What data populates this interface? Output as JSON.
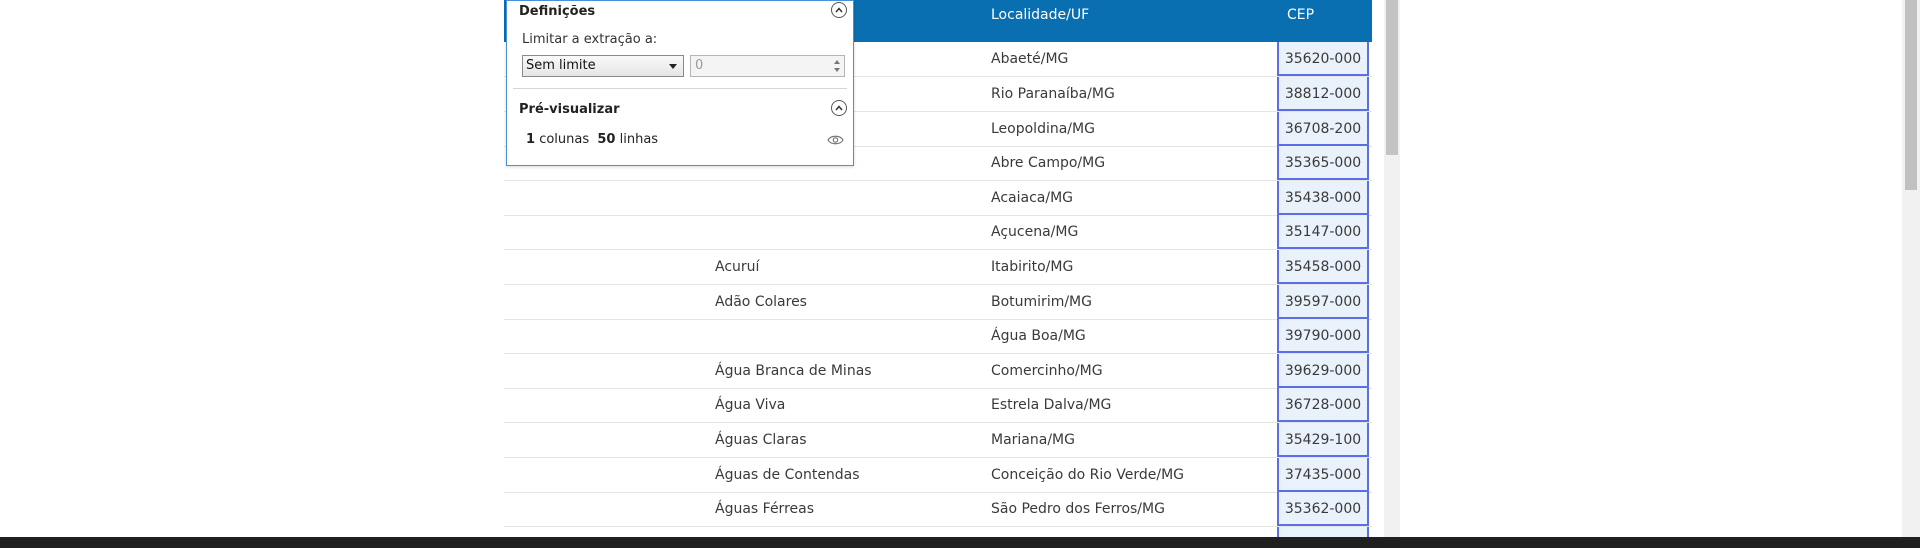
{
  "table": {
    "headers": {
      "localidade": "Localidade/UF",
      "cep": "CEP"
    },
    "rows": [
      {
        "bairro": "",
        "localidade": "Abaeté/MG",
        "cep": "35620-000"
      },
      {
        "bairro": "",
        "localidade": "Rio Paranaíba/MG",
        "cep": "38812-000"
      },
      {
        "bairro": "",
        "localidade": "Leopoldina/MG",
        "cep": "36708-200"
      },
      {
        "bairro": "",
        "localidade": "Abre Campo/MG",
        "cep": "35365-000"
      },
      {
        "bairro": "",
        "localidade": "Acaiaca/MG",
        "cep": "35438-000"
      },
      {
        "bairro": "",
        "localidade": "Açucena/MG",
        "cep": "35147-000"
      },
      {
        "bairro": "Acuruí",
        "localidade": "Itabirito/MG",
        "cep": "35458-000"
      },
      {
        "bairro": "Adão Colares",
        "localidade": "Botumirim/MG",
        "cep": "39597-000"
      },
      {
        "bairro": "",
        "localidade": "Água Boa/MG",
        "cep": "39790-000"
      },
      {
        "bairro": "Água Branca de Minas",
        "localidade": "Comercinho/MG",
        "cep": "39629-000"
      },
      {
        "bairro": "Água Viva",
        "localidade": "Estrela Dalva/MG",
        "cep": "36728-000"
      },
      {
        "bairro": "Águas Claras",
        "localidade": "Mariana/MG",
        "cep": "35429-100"
      },
      {
        "bairro": "Águas de Contendas",
        "localidade": "Conceição do Rio Verde/MG",
        "cep": "37435-000"
      },
      {
        "bairro": "Águas Férreas",
        "localidade": "São Pedro dos Ferros/MG",
        "cep": "35362-000"
      }
    ]
  },
  "panel": {
    "definicoes_title": "Definições",
    "limit_label": "Limitar a extração a:",
    "limit_select_value": "Sem limite",
    "limit_number_value": "0",
    "preview_title": "Pré-visualizar",
    "columns_count": "1",
    "columns_word": "colunas",
    "rows_count": "50",
    "rows_word": "linhas"
  },
  "icons": {
    "collapse": "chevron-up-icon",
    "preview": "eye-icon",
    "select_caret": "caret-down-icon"
  },
  "colors": {
    "header_bg": "#0a6fb0",
    "selected_column_border": "#5a6fe6",
    "selected_column_bg": "#e9f2fb",
    "panel_border": "#4a90d9"
  }
}
